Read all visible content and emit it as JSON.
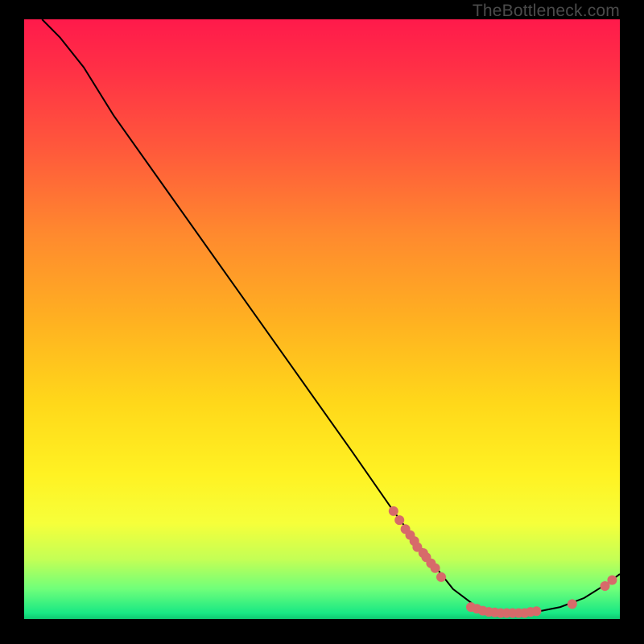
{
  "watermark": "TheBottleneck.com",
  "chart_data": {
    "type": "line",
    "title": "",
    "xlabel": "",
    "ylabel": "",
    "xlim": [
      0,
      100
    ],
    "ylim": [
      0,
      100
    ],
    "curve": [
      {
        "x": 3,
        "y": 100
      },
      {
        "x": 6,
        "y": 97
      },
      {
        "x": 10,
        "y": 92
      },
      {
        "x": 15,
        "y": 84
      },
      {
        "x": 25,
        "y": 70
      },
      {
        "x": 35,
        "y": 56
      },
      {
        "x": 45,
        "y": 42
      },
      {
        "x": 55,
        "y": 28
      },
      {
        "x": 62,
        "y": 18
      },
      {
        "x": 68,
        "y": 10
      },
      {
        "x": 72,
        "y": 5
      },
      {
        "x": 76,
        "y": 2
      },
      {
        "x": 80,
        "y": 1
      },
      {
        "x": 85,
        "y": 1
      },
      {
        "x": 90,
        "y": 2
      },
      {
        "x": 94,
        "y": 3.5
      },
      {
        "x": 98,
        "y": 6
      },
      {
        "x": 100,
        "y": 7.5
      }
    ],
    "points": [
      {
        "x": 62,
        "y": 18
      },
      {
        "x": 63,
        "y": 16.5
      },
      {
        "x": 64,
        "y": 15
      },
      {
        "x": 64.8,
        "y": 14
      },
      {
        "x": 65.5,
        "y": 13
      },
      {
        "x": 66,
        "y": 12
      },
      {
        "x": 67,
        "y": 11
      },
      {
        "x": 67.5,
        "y": 10.3
      },
      {
        "x": 68.3,
        "y": 9.3
      },
      {
        "x": 69,
        "y": 8.5
      },
      {
        "x": 70,
        "y": 7
      },
      {
        "x": 75,
        "y": 2
      },
      {
        "x": 76,
        "y": 1.7
      },
      {
        "x": 77,
        "y": 1.4
      },
      {
        "x": 78,
        "y": 1.2
      },
      {
        "x": 79,
        "y": 1.1
      },
      {
        "x": 80,
        "y": 1
      },
      {
        "x": 81,
        "y": 1
      },
      {
        "x": 82,
        "y": 1
      },
      {
        "x": 83,
        "y": 1
      },
      {
        "x": 84,
        "y": 1
      },
      {
        "x": 85,
        "y": 1.2
      },
      {
        "x": 86,
        "y": 1.3
      },
      {
        "x": 92,
        "y": 2.5
      },
      {
        "x": 97.5,
        "y": 5.5
      },
      {
        "x": 98.7,
        "y": 6.5
      }
    ],
    "colors": {
      "curve": "#000000",
      "dots": "#d76a6a",
      "gradient_top": "#ff1a4b",
      "gradient_bottom": "#0fc771",
      "background": "#000000"
    }
  }
}
